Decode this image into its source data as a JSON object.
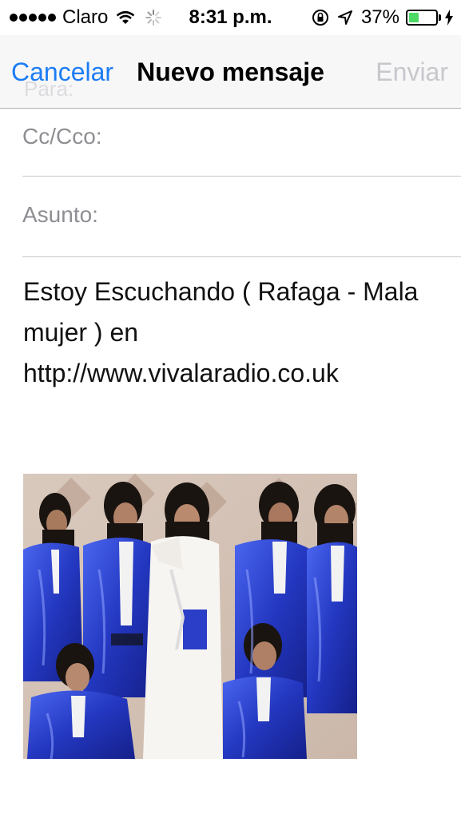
{
  "status_bar": {
    "carrier": "Claro",
    "time": "8:31 p.m.",
    "battery_percent": "37%",
    "battery_level": 0.37,
    "icons": [
      "signal-dots-icon",
      "wifi-icon",
      "activity-spinner-icon",
      "rotation-lock-icon",
      "location-arrow-icon",
      "battery-icon",
      "charging-bolt-icon"
    ]
  },
  "nav": {
    "cancel_label": "Cancelar",
    "title": "Nuevo mensaje",
    "send_label": "Enviar",
    "faded_label": "Para:"
  },
  "fields": {
    "cc_label": "Cc/Cco:",
    "cc_value": "",
    "subject_label": "Asunto:",
    "subject_value": ""
  },
  "body": {
    "line1": "Estoy Escuchando ( Rafaga - Mala",
    "line2": "mujer ) en",
    "line3": "http://www.vivalaradio.co.uk"
  },
  "colors": {
    "accent": "#1c7cf5",
    "disabled": "#c7c7cc",
    "battery_green": "#4cd964",
    "suit_blue": "#2a3fc9"
  }
}
